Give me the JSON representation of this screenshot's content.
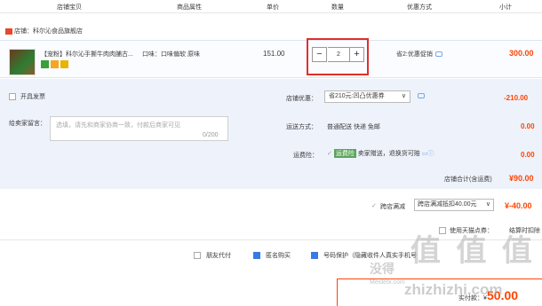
{
  "header": {
    "col_item": "店铺宝贝",
    "col_attr": "商品属性",
    "col_price": "单价",
    "col_qty": "数量",
    "col_promo": "优惠方式",
    "col_subtotal": "小计"
  },
  "shop": {
    "label": "店铺：科尔沁食品旗舰店"
  },
  "item": {
    "title": "【宠粉】科尔沁手撕牛肉肉脯古...",
    "attr": "口味：口味偏软 原味",
    "price": "151.00",
    "qty": "2",
    "minus_label": "−",
    "plus_label": "+",
    "promo": "省2:优惠促销",
    "subtotal": "300.00"
  },
  "invoice": {
    "label": "开具发票"
  },
  "message": {
    "label": "给卖家留言：",
    "placeholder": "选填，请先和商家协商一致，付款后商家可见",
    "count": "0/200"
  },
  "coupon": {
    "label": "店铺优惠：",
    "selected": "省210元:凹凸优惠券",
    "amount": "-210.00"
  },
  "shipping": {
    "label": "运送方式：",
    "value": "普通配送 快递 免邮",
    "amount": "0.00"
  },
  "insurance": {
    "label": "运费险：",
    "tag": "运费险",
    "value": "卖家赠送，退换货可赔",
    "amount": "0.00"
  },
  "shop_total": {
    "label": "店铺合计(含运费)",
    "amount": "¥90.00"
  },
  "cross_shop": {
    "label": "跨店满减",
    "selected": "跨店满减抵扣40.00元",
    "amount": "¥-40.00"
  },
  "tmall_points": {
    "label": "使用天猫点券：",
    "note": "结算时扣除"
  },
  "options": {
    "friend_pay": "朋友代付",
    "anonymous": "匿名购买",
    "privacy": "号码保护（隐藏收件人真实手机号"
  },
  "payment": {
    "label": "实付款：¥",
    "amount": "50.00"
  },
  "watermark": {
    "main": "值 值 值",
    "sub1": "没得",
    "sub2": "Meidebi.com",
    "sub3": "zhizhizhi.com"
  },
  "colors": {
    "accent": "#ff4400",
    "highlight_border": "#e0302a",
    "panel_bg": "#eef2fb"
  }
}
